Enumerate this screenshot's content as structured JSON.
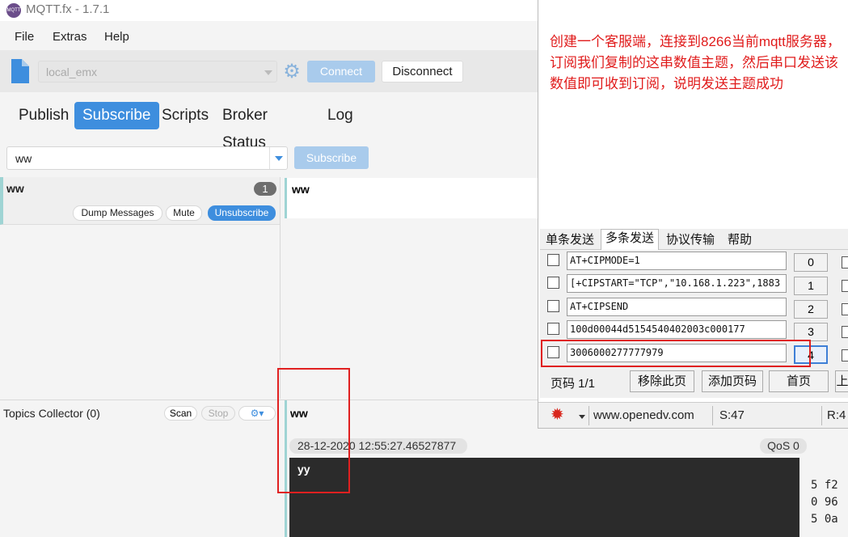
{
  "app": {
    "title": "MQTT.fx - 1.7.1",
    "logo_text": "MQTT"
  },
  "menu": [
    "File",
    "Extras",
    "Help"
  ],
  "toolbar": {
    "profile": "local_emx",
    "connect": "Connect",
    "disconnect": "Disconnect"
  },
  "tabs": [
    "Publish",
    "Subscribe",
    "Scripts",
    "Broker Status",
    "Log"
  ],
  "subscribe": {
    "topic": "ww",
    "button": "Subscribe"
  },
  "subscription": {
    "topic": "ww",
    "count": "1",
    "dump": "Dump Messages",
    "mute": "Mute",
    "unsubscribe": "Unsubscribe"
  },
  "messages_header": "ww",
  "topics_collector": {
    "label": "Topics Collector (0)",
    "scan": "Scan",
    "stop": "Stop"
  },
  "message": {
    "topic": "ww",
    "timestamp": "28-12-2020  12:55:27.46527877",
    "qos": "QoS 0",
    "payload": "yy"
  },
  "hex_lines": [
    "5 f2",
    "0 96",
    "5 0a"
  ],
  "serial": {
    "note": "创建一个客服端，连接到8266当前mqtt服务器，订阅我们复制的这串数值主题，然后串口发送该数值即可收到订阅，说明发送主题成功",
    "tabs": [
      "单条发送",
      "多条发送",
      "协议传输",
      "帮助"
    ],
    "rows": [
      {
        "cmd": "AT+CIPMODE=1",
        "num": "0"
      },
      {
        "cmd": "[+CIPSTART=\"TCP\",\"10.168.1.223\",1883",
        "num": "1"
      },
      {
        "cmd": "AT+CIPSEND",
        "num": "2"
      },
      {
        "cmd": "100d00044d5154540402003c000177",
        "num": "3"
      },
      {
        "cmd": "3006000277777979",
        "num": "4"
      }
    ],
    "page_label": "页码 1/1",
    "buttons": [
      "移除此页",
      "添加页码",
      "首页",
      "上"
    ],
    "status": {
      "url": "www.openedv.com",
      "s": "S:47",
      "r": "R:4"
    }
  }
}
